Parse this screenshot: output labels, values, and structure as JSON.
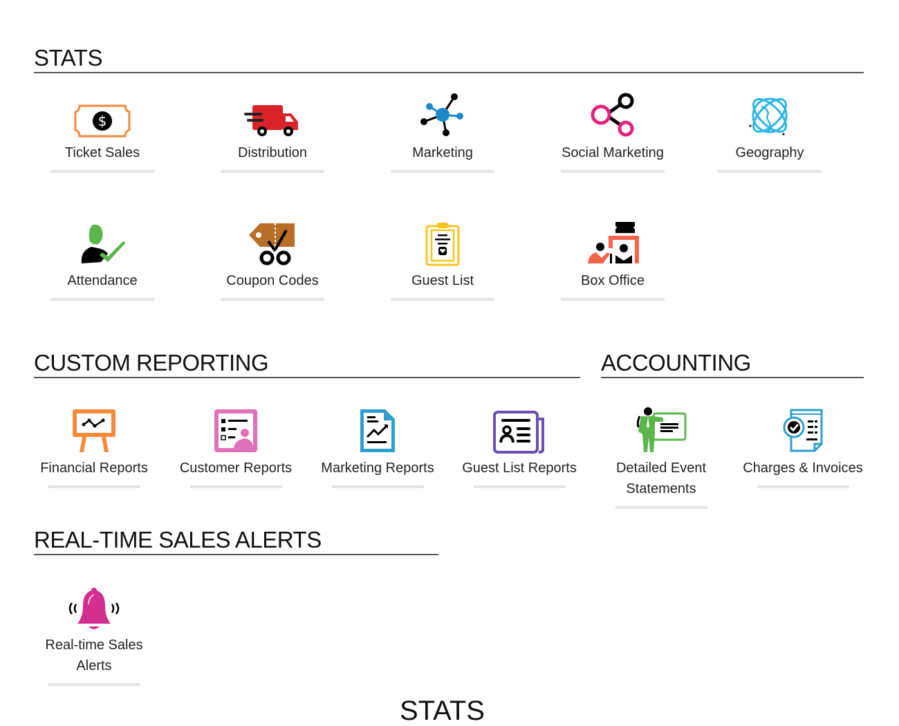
{
  "sections": {
    "stats": {
      "title": "STATS",
      "items": [
        {
          "label": "Ticket Sales",
          "icon": "ticket-dollar-icon"
        },
        {
          "label": "Distribution",
          "icon": "delivery-truck-icon"
        },
        {
          "label": "Marketing",
          "icon": "network-hub-icon"
        },
        {
          "label": "Social Marketing",
          "icon": "share-nodes-icon"
        },
        {
          "label": "Geography",
          "icon": "globe-orbit-icon"
        },
        {
          "label": "Attendance",
          "icon": "user-check-icon"
        },
        {
          "label": "Coupon Codes",
          "icon": "coupon-scissors-icon"
        },
        {
          "label": "Guest List",
          "icon": "clipboard-heart-icon"
        },
        {
          "label": "Box Office",
          "icon": "box-office-icon"
        }
      ]
    },
    "custom_reporting": {
      "title": "CUSTOM REPORTING",
      "items": [
        {
          "label": "Financial Reports",
          "icon": "presentation-board-icon"
        },
        {
          "label": "Customer Reports",
          "icon": "customer-list-icon"
        },
        {
          "label": "Marketing Reports",
          "icon": "growth-document-icon"
        },
        {
          "label": "Guest List Reports",
          "icon": "newspaper-profile-icon"
        }
      ]
    },
    "accounting": {
      "title": "ACCOUNTING",
      "items": [
        {
          "label_line1": "Detailed Event",
          "label_line2": "Statements",
          "icon": "presenter-board-icon"
        },
        {
          "label": "Charges & Invoices",
          "icon": "invoice-check-icon"
        }
      ]
    },
    "alerts": {
      "title": "REAL-TIME SALES ALERTS",
      "items": [
        {
          "label_line1": "Real-time Sales",
          "label_line2": "Alerts",
          "icon": "ringing-bell-icon"
        }
      ]
    },
    "next_section_partial": {
      "title": "STATS"
    }
  },
  "colors": {
    "orange": "#f58a3c",
    "red": "#d9222a",
    "blue": "#1e88c8",
    "pink": "#e0257f",
    "cyan": "#2bb5e8",
    "green": "#5bb64b",
    "brown": "#b86e27",
    "yellow": "#f7c51c",
    "coral": "#f4664a",
    "lightpink": "#e071b8",
    "teal": "#2d9fcf",
    "purple": "#6a4fb3",
    "magenta": "#d12e8e",
    "bar": "#e4e4e4",
    "rule": "#555555"
  }
}
